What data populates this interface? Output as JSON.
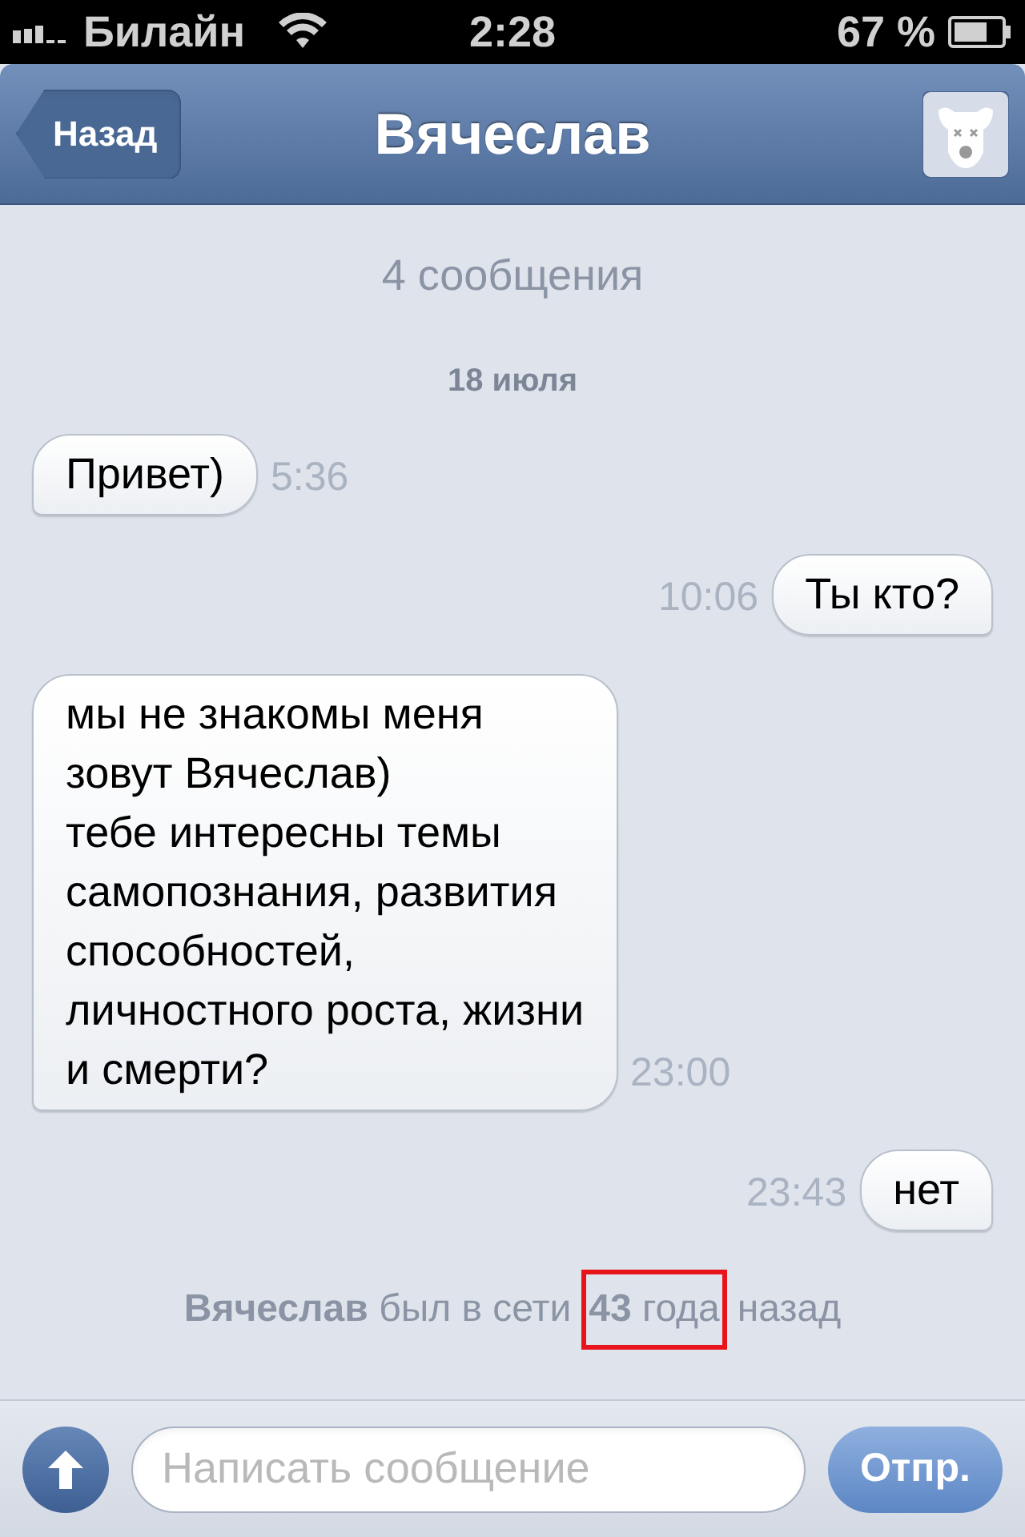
{
  "status_bar": {
    "carrier": "Билайн",
    "time": "2:28",
    "battery": "67 %"
  },
  "nav": {
    "back": "Назад",
    "title": "Вячеслав"
  },
  "count": "4 сообщения",
  "date": "18 июля",
  "messages": [
    {
      "kind": "incoming",
      "text": "Привет)",
      "time": "5:36"
    },
    {
      "kind": "outgoing",
      "text": "Ты кто?",
      "time": "10:06"
    },
    {
      "kind": "incoming",
      "text": "мы не знакомы меня\nзовут Вячеслав)\nтебе интересны темы\nсамопознания, развития\nспособностей,\nличностного роста, жизни\nи смерти?",
      "time": "23:00"
    },
    {
      "kind": "outgoing",
      "text": "нет",
      "time": "23:43"
    }
  ],
  "last_seen": {
    "before": "**Вячеслав** был в сети",
    "highlighted": "**43** года",
    "after": "назад"
  },
  "composer": {
    "placeholder": "Написать сообщение",
    "send": "Отпр."
  }
}
